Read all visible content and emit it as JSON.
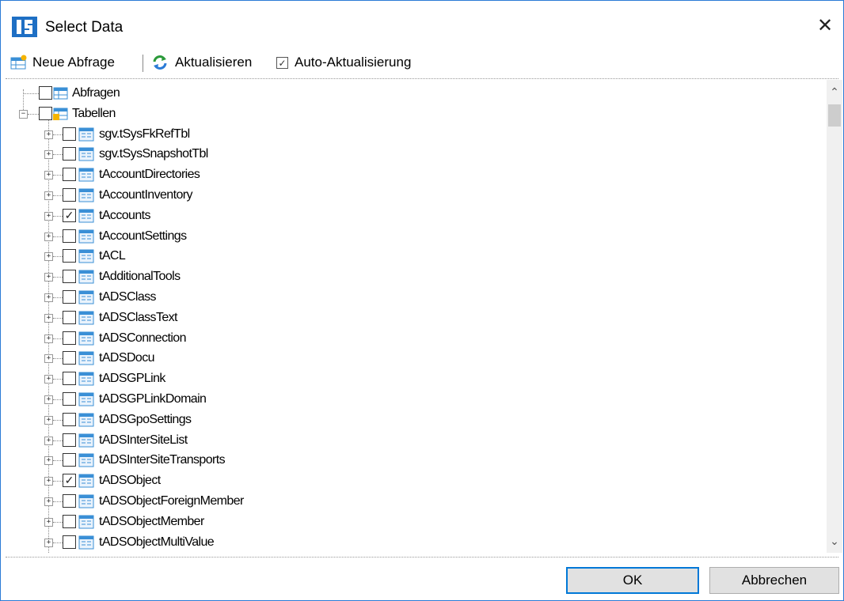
{
  "window": {
    "title": "Select Data",
    "close_glyph": "✕"
  },
  "toolbar": {
    "new_query_label": "Neue Abfrage",
    "refresh_label": "Aktualisieren",
    "auto_refresh_label": "Auto-Aktualisierung",
    "auto_refresh_checked": true
  },
  "tree": {
    "roots": [
      {
        "label": "Abfragen",
        "checked": false,
        "expanded": false,
        "icon": "queries-folder-icon"
      },
      {
        "label": "Tabellen",
        "checked": false,
        "expanded": true,
        "icon": "tables-folder-icon"
      }
    ],
    "tables": [
      {
        "label": "sgv.tSysFkRefTbl",
        "checked": false
      },
      {
        "label": "sgv.tSysSnapshotTbl",
        "checked": false
      },
      {
        "label": "tAccountDirectories",
        "checked": false
      },
      {
        "label": "tAccountInventory",
        "checked": false
      },
      {
        "label": "tAccounts",
        "checked": true
      },
      {
        "label": "tAccountSettings",
        "checked": false
      },
      {
        "label": "tACL",
        "checked": false
      },
      {
        "label": "tAdditionalTools",
        "checked": false
      },
      {
        "label": "tADSClass",
        "checked": false
      },
      {
        "label": "tADSClassText",
        "checked": false
      },
      {
        "label": "tADSConnection",
        "checked": false
      },
      {
        "label": "tADSDocu",
        "checked": false
      },
      {
        "label": "tADSGPLink",
        "checked": false
      },
      {
        "label": "tADSGPLinkDomain",
        "checked": false
      },
      {
        "label": "tADSGpoSettings",
        "checked": false
      },
      {
        "label": "tADSInterSiteList",
        "checked": false
      },
      {
        "label": "tADSInterSiteTransports",
        "checked": false
      },
      {
        "label": "tADSObject",
        "checked": true
      },
      {
        "label": "tADSObjectForeignMember",
        "checked": false
      },
      {
        "label": "tADSObjectMember",
        "checked": false
      },
      {
        "label": "tADSObjectMultiValue",
        "checked": false
      },
      {
        "label": "",
        "checked": false
      }
    ]
  },
  "footer": {
    "ok_label": "OK",
    "cancel_label": "Abbrechen"
  },
  "colors": {
    "accent": "#0078d7",
    "table_icon": "#3a8fd6"
  }
}
